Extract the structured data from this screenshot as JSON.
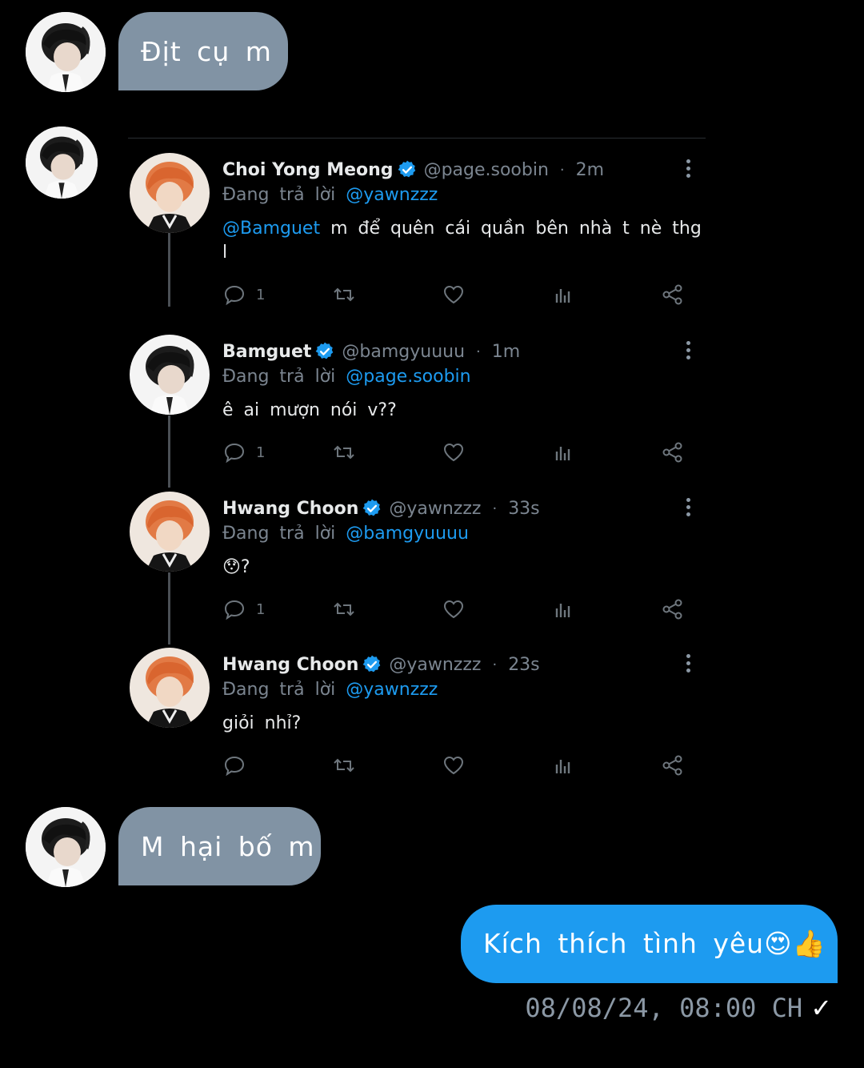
{
  "messages": {
    "m1": "Địt cụ m",
    "m2": "M hại bố m",
    "m3": "Kích thích tình yêu😍👍"
  },
  "thread": {
    "tweets": [
      {
        "name": "Choi Yong Meong",
        "handle": "@page.soobin",
        "time": "2m",
        "reply_prefix": "Đang trả lời",
        "reply_to": "@yawnzzz",
        "mention": "@Bamguet",
        "body": " m để quên cái quần bên nhà t nè thg l",
        "reply_count": "1"
      },
      {
        "name": "Bamguet",
        "handle": "@bamgyuuuu",
        "time": "1m",
        "reply_prefix": "Đang trả lời",
        "reply_to": "@page.soobin",
        "body": "ê ai mượn nói v??",
        "reply_count": "1"
      },
      {
        "name": "Hwang Choon",
        "handle": "@yawnzzz",
        "time": "33s",
        "reply_prefix": "Đang trả lời",
        "reply_to": "@bamgyuuuu",
        "body": "😯?",
        "reply_count": "1"
      },
      {
        "name": "Hwang Choon",
        "handle": "@yawnzzz",
        "time": "23s",
        "reply_prefix": "Đang trả lời",
        "reply_to": "@yawnzzz",
        "body": "giỏi nhỉ?",
        "reply_count": ""
      }
    ]
  },
  "status": {
    "timestamp": "08/08/24, 08:00 CH",
    "check": "✓"
  },
  "colors": {
    "background": "#000000",
    "incoming_bubble": "#8193a4",
    "outgoing_bubble": "#1d9bf0",
    "mention": "#1d9bf0"
  },
  "icons": [
    "reply-icon",
    "retweet-icon",
    "like-icon",
    "views-icon",
    "share-icon",
    "verified-icon",
    "more-icon"
  ]
}
